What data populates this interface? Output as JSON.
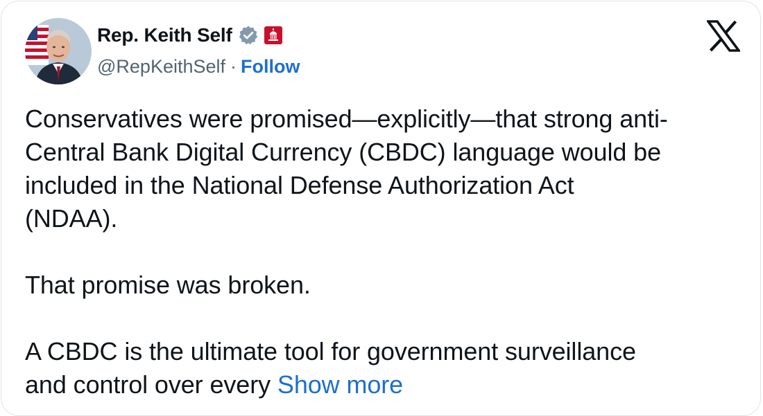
{
  "author": {
    "display_name": "Rep. Keith Self",
    "handle": "@RepKeithSelf",
    "separator": "·",
    "follow_label": "Follow",
    "verified_badge_icon": "verified-badge-icon",
    "government_badge_icon": "us-capitol-badge-icon"
  },
  "platform": {
    "logo_icon": "x-logo-icon"
  },
  "tweet": {
    "paragraph_1_line_1": "Conservatives were promised—explicitly—that strong anti-",
    "paragraph_1_line_2": "Central Bank Digital Currency (CBDC) language would be",
    "paragraph_1_line_3": "included in the National Defense Authorization Act",
    "paragraph_1_line_4": "(NDAA).",
    "paragraph_2": "That promise was broken.",
    "paragraph_3_line_1": "A CBDC is the ultimate tool for government surveillance",
    "paragraph_3_line_2": "and control over every",
    "show_more_label": "Show more"
  },
  "colors": {
    "text_primary": "#0f1419",
    "text_secondary": "#536471",
    "link": "#1d6fd0",
    "verified_badge": "#829aab",
    "gov_badge": "#c8102e",
    "card_border": "#dfe3e7"
  }
}
